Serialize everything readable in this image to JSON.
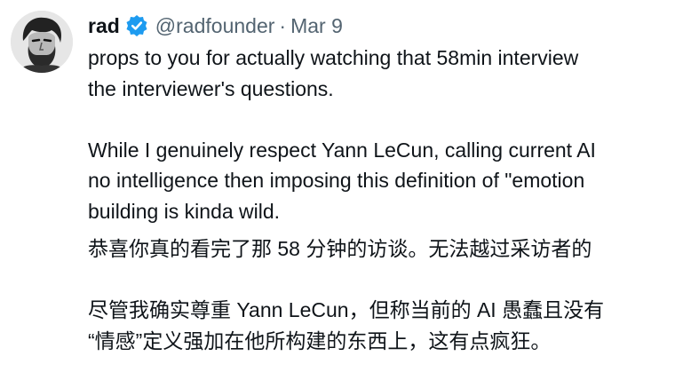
{
  "tweet": {
    "author": {
      "name": "rad",
      "handle": "@radfounder",
      "separator": "·",
      "date": "Mar 9",
      "verified": true,
      "avatar_icon": "bearded-man-avatar",
      "verified_icon": "verified-badge-icon"
    },
    "text": {
      "en_line1": "props to you for actually watching that 58min interview",
      "en_line2": "the interviewer's questions.",
      "en_line3": "While I genuinely respect Yann LeCun, calling current AI",
      "en_line4": "no intelligence then imposing this definition of \"emotion",
      "en_line5": "building is kinda wild.",
      "zh_line1": "恭喜你真的看完了那 58 分钟的访谈。无法越过采访者的",
      "zh_line2": "尽管我确实尊重 Yann LeCun，但称当前的 AI 愚蠢且没有",
      "zh_line3": "“情感”定义强加在他所构建的东西上，这有点疯狂。"
    }
  },
  "colors": {
    "text": "#0f1419",
    "secondary": "#536471",
    "verified": "#1d9bf0"
  }
}
